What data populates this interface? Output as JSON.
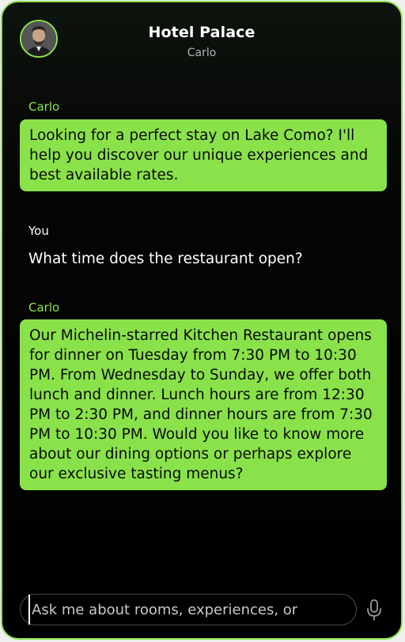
{
  "header": {
    "title": "Hotel Palace",
    "subtitle": "Carlo",
    "avatar_icon": "person-avatar-icon"
  },
  "messages": [
    {
      "sender": "Carlo",
      "role": "bot",
      "text": "Looking for a perfect stay on Lake Como? I'll help you discover our unique experiences and best available rates."
    },
    {
      "sender": "You",
      "role": "user",
      "text": "What time does the restaurant open?"
    },
    {
      "sender": "Carlo",
      "role": "bot",
      "text": "Our Michelin-starred Kitchen Restaurant opens for dinner on Tuesday from 7:30 PM to 10:30 PM. From Wednesday to Sunday, we offer both lunch and dinner. Lunch hours are from 12:30 PM to 2:30 PM, and dinner hours are from 7:30 PM to 10:30 PM. Would you like to know more about our dining options or perhaps explore our exclusive tasting menus?"
    }
  ],
  "composer": {
    "placeholder": "Ask me about rooms, experiences, or",
    "value": "",
    "mic_icon": "microphone-icon"
  },
  "colors": {
    "accent": "#8ae24a",
    "background": "#000000",
    "bubble_text": "#0a0a0a",
    "user_text": "#ffffff",
    "subtitle": "#b5b5b5"
  }
}
